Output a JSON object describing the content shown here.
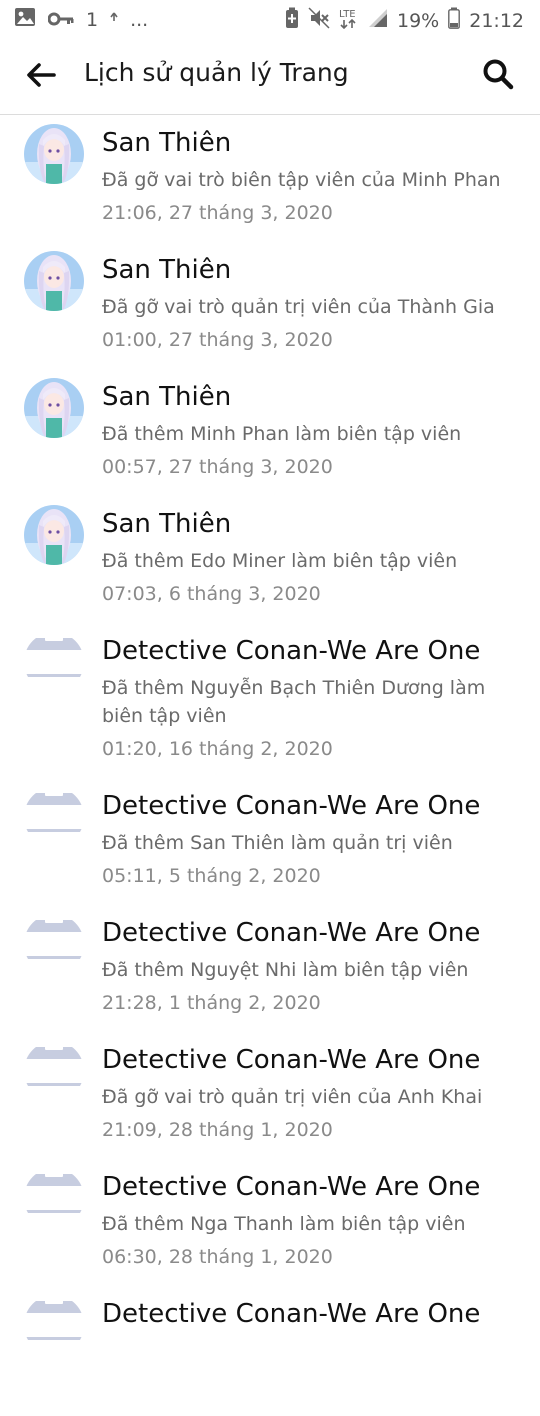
{
  "status_bar": {
    "left_icons": [
      "gallery-icon",
      "key-icon",
      "upload-icon"
    ],
    "left_text": "1",
    "ellipsis": "...",
    "right_icons": [
      "battery-saver-icon",
      "mute-icon",
      "lte-icon",
      "signal-icon"
    ],
    "lte_label": "LTE",
    "battery": "19%",
    "time": "21:12"
  },
  "header": {
    "title": "Lịch sử quản lý Trang",
    "back_icon": "back-arrow-icon",
    "search_icon": "search-icon"
  },
  "accent_colors": {
    "avatar_anime_bg": "#9ec7f0",
    "page_avatar_bar": "#c7cde0"
  },
  "activities": [
    {
      "avatar": "user-avatar-anime",
      "name": "San Thiên",
      "action": "Đã gỡ vai trò biên tập viên của Minh Phan",
      "time": "21:06, 27 tháng 3, 2020"
    },
    {
      "avatar": "user-avatar-anime",
      "name": "San Thiên",
      "action": "Đã gỡ vai trò quản trị viên của Thành Gia",
      "time": "01:00, 27 tháng 3, 2020"
    },
    {
      "avatar": "user-avatar-anime",
      "name": "San Thiên",
      "action": "Đã thêm Minh Phan làm biên tập viên",
      "time": "00:57, 27 tháng 3, 2020"
    },
    {
      "avatar": "user-avatar-anime",
      "name": "San Thiên",
      "action": "Đã thêm Edo Miner làm biên tập viên",
      "time": "07:03, 6 tháng 3, 2020"
    },
    {
      "avatar": "page-avatar",
      "name": "Detective Conan-We Are One",
      "action": "Đã thêm Nguyễn Bạch Thiên Dương làm biên tập viên",
      "time": "01:20, 16 tháng 2, 2020"
    },
    {
      "avatar": "page-avatar",
      "name": "Detective Conan-We Are One",
      "action": "Đã thêm San Thiên làm quản trị viên",
      "time": "05:11, 5 tháng 2, 2020"
    },
    {
      "avatar": "page-avatar",
      "name": "Detective Conan-We Are One",
      "action": "Đã thêm Nguyệt Nhi làm biên tập viên",
      "time": "21:28, 1 tháng 2, 2020"
    },
    {
      "avatar": "page-avatar",
      "name": "Detective Conan-We Are One",
      "action": "Đã gỡ vai trò quản trị viên của Anh Khai",
      "time": "21:09, 28 tháng 1, 2020"
    },
    {
      "avatar": "page-avatar",
      "name": "Detective Conan-We Are One",
      "action": "Đã thêm Nga Thanh làm biên tập viên",
      "time": "06:30, 28 tháng 1, 2020"
    },
    {
      "avatar": "page-avatar",
      "name": "Detective Conan-We Are One",
      "action": "",
      "time": ""
    }
  ]
}
